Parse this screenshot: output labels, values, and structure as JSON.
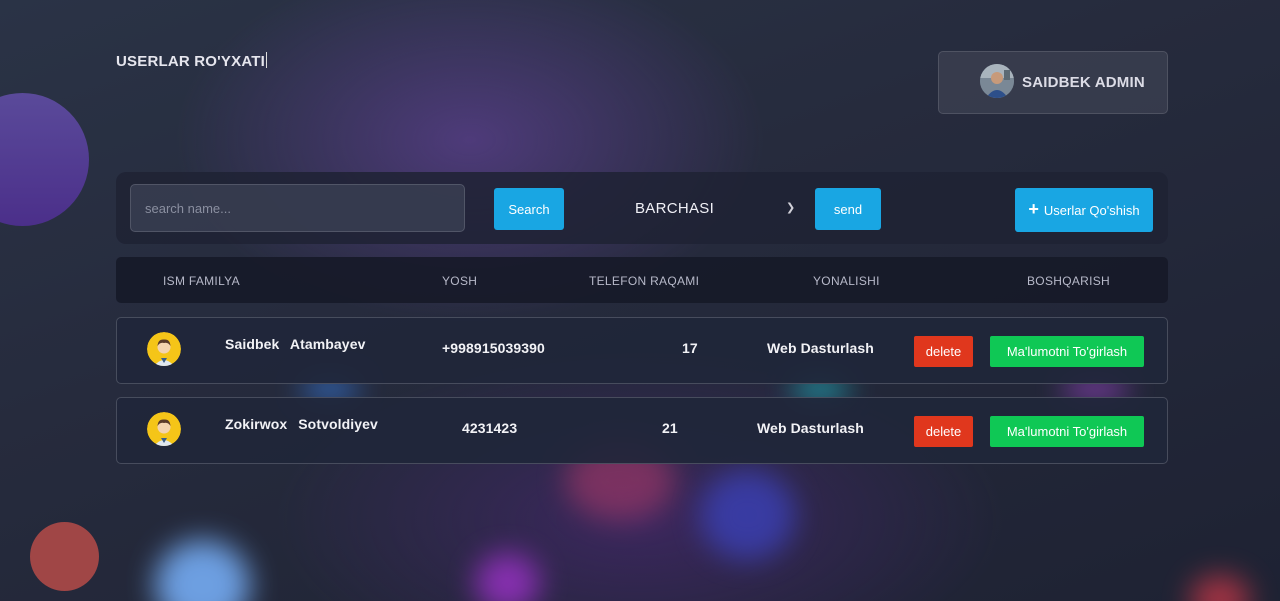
{
  "page": {
    "title": "USERLAR RO'YXATI"
  },
  "admin": {
    "name": "SAIDBEK ADMIN"
  },
  "toolbar": {
    "search_placeholder": "search name...",
    "search_value": "",
    "search_label": "Search",
    "filter_selected": "BARCHASI",
    "send_label": "send",
    "add_label": "Userlar Qo'shish"
  },
  "table": {
    "headers": [
      "ISM FAMILYA",
      "YOSH",
      "TELEFON RAQAMI",
      "YONALISHI",
      "BOSHQARISH"
    ],
    "rows": [
      {
        "name": "Saidbek Atambayev",
        "phone": "+998915039390",
        "age": "17",
        "direction": "Web Dasturlash",
        "delete_label": "delete",
        "edit_label": "Ma'lumotni To'girlash"
      },
      {
        "name": "Zokirwox Sotvoldiyev",
        "phone": "4231423",
        "age": "21",
        "direction": "Web Dasturlash",
        "delete_label": "delete",
        "edit_label": "Ma'lumotni To'girlash"
      }
    ]
  },
  "colors": {
    "accent_blue": "#19a6e3",
    "delete_red": "#e0371d",
    "edit_green": "#0fc855"
  }
}
